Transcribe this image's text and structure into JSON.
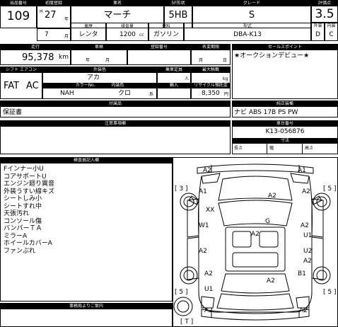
{
  "header": {
    "lot_label": "出品番号",
    "lot_no": "109",
    "first_reg_label": "初度登録",
    "era": "H",
    "year": "27",
    "year_unit": "年",
    "month": "7",
    "month_unit": "月",
    "car_name_label": "車名",
    "car_name": "マーチ",
    "shape_label": "5F形状",
    "shape": "5HB",
    "grade_label": "グレード",
    "grade": "S",
    "score_label": "評価点",
    "score": "3.5",
    "exterior_label": "外装",
    "interior_label": "内装",
    "exterior": "D",
    "interior": "C",
    "vehicle_type_label": "車歴",
    "vehicle_type": "レンタ",
    "displacement_label": "排気量",
    "displacement": "1200",
    "displacement_unit": "cc",
    "fuel_label": "燃料",
    "fuel": "ガソリン",
    "model_label": "型式",
    "model": "DBA-K13"
  },
  "row2": {
    "mileage_label": "走行",
    "mileage": "95,378",
    "mileage_unit": "km",
    "inspection_label": "車検",
    "year_unit": "年",
    "month_unit": "月",
    "reg_no_label": "登録番号",
    "name_change_label": "名変期限",
    "day_unit": "日",
    "sales_point_label": "セールスポイント",
    "sales_point": "★オークションデビュー★"
  },
  "specs": {
    "shift_label": "シフト",
    "ac_label": "エアコン",
    "shift": "FAT",
    "ac": "AC",
    "exterior_color_label": "外装色",
    "exterior_color": "アカ",
    "capacity_label": "乗車定員",
    "capacity_unit": "人",
    "max_load_label": "最大積載",
    "max_load_unit": "kg",
    "color_no_label": "カラーNo.",
    "color_no": "NAH",
    "interior_color_label": "内装色",
    "interior_color": "クロ",
    "pattern_suffix": "系",
    "import_label": "輸入",
    "recycle_label": "リサイクル預託金",
    "recycle_fee": "8,350",
    "yen": "円"
  },
  "equipment": {
    "accessories_label": "付属品",
    "warranty": "保証書",
    "options_label": "純正装備",
    "options": "ナビ ABS 17B PS PW"
  },
  "notes": {
    "label": "注意事項欄",
    "chassis_label": "車台番号",
    "chassis_no": "K13-056876",
    "dimensions_label": "寸法",
    "length_label": "長さ",
    "width_label": "幅",
    "height_label": "高さ"
  },
  "inspector": {
    "label": "検査員記入欄",
    "lines": [
      "Fインナー小U",
      "コアサポートU",
      "エンジン廻り異音",
      "外装うすい線キズ",
      "シートしみ小",
      "シートすれ中",
      "天張汚れ",
      "コンソール傷",
      "バンパーＴＡ",
      "ミラーA",
      "ホイールカバーA",
      "ファンぶれ"
    ]
  },
  "office_label": "事務局よりご案内",
  "diagram_marks": [
    {
      "id": "front-left-bumper",
      "text": "A2"
    },
    {
      "id": "front-right-bumper",
      "text": "A1"
    },
    {
      "id": "front-left-fender",
      "text": "A1"
    },
    {
      "id": "hood",
      "text": "A2"
    },
    {
      "id": "front-right-fender",
      "text": "A2"
    },
    {
      "id": "windshield",
      "text": "XX"
    },
    {
      "id": "roof",
      "text": "G"
    },
    {
      "id": "left-front-door",
      "text": "W1"
    },
    {
      "id": "right-front-door-1",
      "text": "A2"
    },
    {
      "id": "right-front-door-2",
      "text": "U1"
    },
    {
      "id": "center",
      "text": "A2"
    },
    {
      "id": "left-rear-door",
      "text": "A2"
    },
    {
      "id": "right-rear-door",
      "text": "U2"
    },
    {
      "id": "right-rear-quarter",
      "text": "A2"
    },
    {
      "id": "left-rear-quarter",
      "text": "A2"
    },
    {
      "id": "right-rear-wheel",
      "text": "B1"
    },
    {
      "id": "trunk",
      "text": "A2"
    },
    {
      "id": "left-rear-bumper",
      "text": "U1"
    },
    {
      "id": "rear-bumper-left",
      "text": "A2"
    },
    {
      "id": "rear-bumper-right",
      "text": "A2"
    }
  ],
  "tire_depths": {
    "front_left": "[ 3 ]",
    "front_right": "[ 5 ]",
    "rear_left": "[ 5 ]",
    "rear_right": "[ 5 ]",
    "spare": "[ T ]"
  }
}
